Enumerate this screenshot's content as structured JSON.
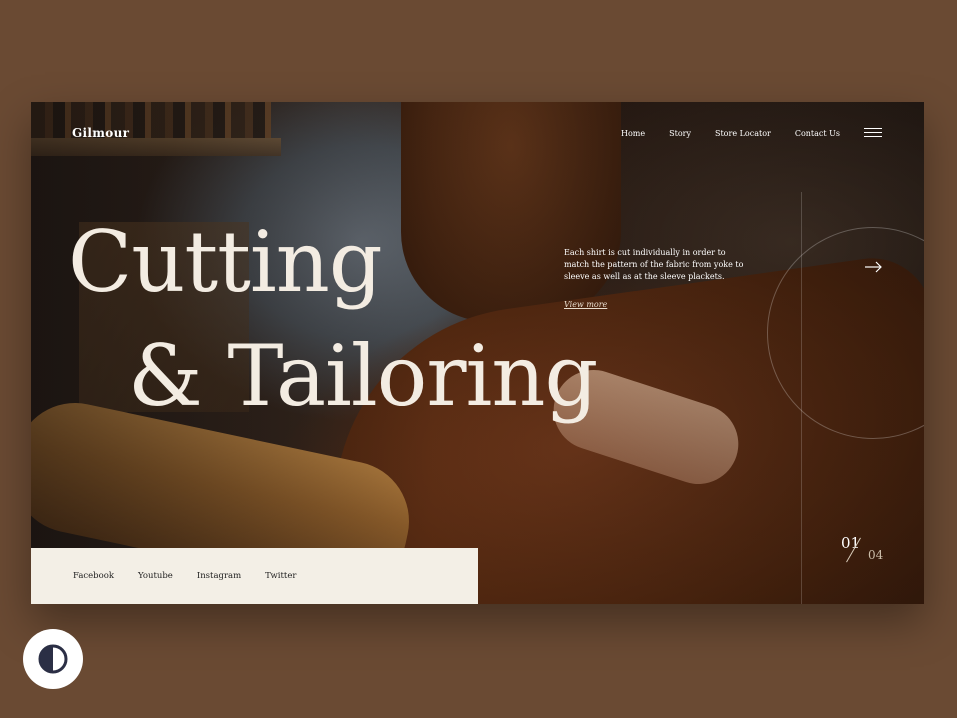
{
  "brand": {
    "logo": "Gilmour"
  },
  "nav": {
    "items": [
      "Home",
      "Story",
      "Store Locator",
      "Contact Us"
    ],
    "menu_icon": "hamburger-menu-icon"
  },
  "hero": {
    "line1": "Cutting",
    "line2": "& Tailoring",
    "description": "Each shirt is cut individually in order to match the pattern of the fabric from yoke to sleeve as well as at the sleeve plackets.",
    "view_more": "View more",
    "next_icon": "arrow-right-icon"
  },
  "slider": {
    "current": "01",
    "total": "04"
  },
  "social": {
    "items": [
      "Facebook",
      "Youtube",
      "Instagram",
      "Twitter"
    ]
  },
  "theme_toggle": {
    "icon": "contrast-icon"
  },
  "colors": {
    "page_bg": "#6a4a33",
    "hero_text": "#f3ece2",
    "social_bar": "#f3efe6"
  }
}
